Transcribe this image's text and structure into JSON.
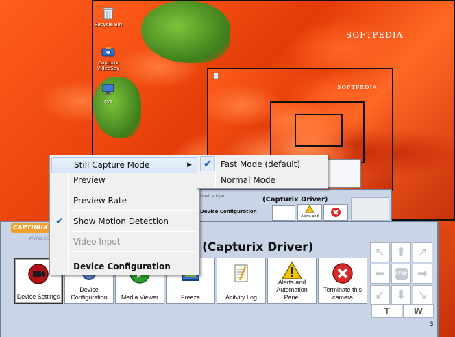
{
  "desktop": {
    "watermark": "SOFTPEDIA",
    "icons": [
      {
        "label": "Recycle Bin",
        "icon": "recycle-bin-icon"
      },
      {
        "label": "Capturix VideoSpy",
        "icon": "camera-app-icon"
      },
      {
        "label": "cvs",
        "icon": "computer-icon"
      }
    ]
  },
  "inner_capture": {
    "device_input": "Device Input",
    "device_configuration": "Device Configuration",
    "title": "(Capturix Driver)",
    "buttons": [
      "Alerts and",
      ""
    ]
  },
  "window": {
    "logo": "CAPTURIX",
    "subtext": "www.softpedia.com",
    "title": "(Capturix Driver)",
    "page_number": "3",
    "toolbar": [
      {
        "label": "Device Settings",
        "icon": "camera-icon"
      },
      {
        "label": "Device Configuration",
        "icon": "gear-icon"
      },
      {
        "label": "Media Viewer",
        "icon": "play-icon"
      },
      {
        "label": "Freeze",
        "icon": "freeze-icon"
      },
      {
        "label": "Acitvity Log",
        "icon": "notepad-icon"
      },
      {
        "label": "Alerts and Automation Panel",
        "icon": "warning-icon"
      },
      {
        "label": "Terminate this camera",
        "icon": "terminate-icon"
      }
    ],
    "nav": {
      "stop": "STOP",
      "t_label": "T",
      "w_label": "W"
    }
  },
  "context_menu": {
    "items": [
      {
        "label": "Still Capture Mode",
        "submenu": true,
        "highlighted": true
      },
      {
        "label": "Preview"
      },
      {
        "label": "Preview Rate"
      },
      {
        "label": "Show Motion Detection",
        "checked": true
      },
      {
        "label": "Video Input",
        "disabled": true
      },
      {
        "label": "Device Configuration",
        "bold": true
      }
    ],
    "submenu": [
      {
        "label": "Fast Mode (default)",
        "checked": true
      },
      {
        "label": "Normal Mode"
      }
    ]
  },
  "colors": {
    "panel_bg": "#c9d5e6",
    "menu_bg": "#f0f0f0",
    "highlight": "#d6e6f7",
    "check": "#2457b0",
    "terminate": "#d8282a",
    "warning": "#f3c400",
    "accent_orange": "#f0a030"
  }
}
